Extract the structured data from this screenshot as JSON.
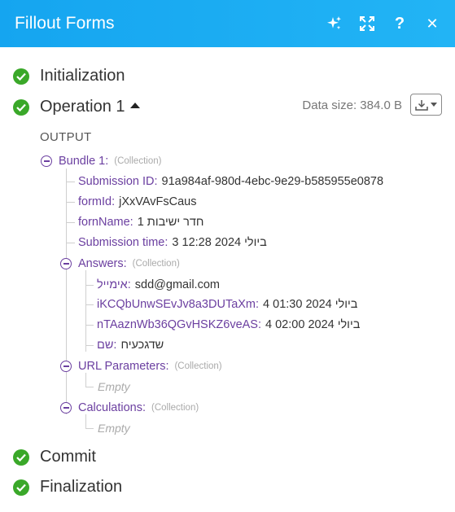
{
  "header": {
    "title": "Fillout Forms",
    "icons": [
      "sparkle-icon",
      "expand-icon",
      "help-icon",
      "close-icon"
    ],
    "help_glyph": "?",
    "close_glyph": "✕"
  },
  "steps": {
    "initialization": "Initialization",
    "operation": "Operation 1",
    "commit": "Commit",
    "finalization": "Finalization"
  },
  "data_size": "Data size: 384.0 B",
  "output_label": "OUTPUT",
  "bundle": {
    "key": "Bundle 1:",
    "type": "(Collection)",
    "submission_id": {
      "key": "Submission ID:",
      "value": "91a984af-980d-4ebc-9e29-b585955e0878"
    },
    "form_id": {
      "key": "formId:",
      "value": "jXxVAvFsCaus"
    },
    "form_name": {
      "key": "fornName:",
      "value": "חדר ישיבות 1"
    },
    "submission_time": {
      "key": "Submission time:",
      "value": "3 ביולי 2024 12:28"
    },
    "answers": {
      "key": "Answers:",
      "type": "(Collection)",
      "email": {
        "key": "אימייל:",
        "value": "sdd@gmail.com"
      },
      "field1": {
        "key": "iKCQbUnwSEvJv8a3DUTaXm:",
        "value": "4 ביולי 2024 01:30"
      },
      "field2": {
        "key": "nTAaznWb36QGvHSKZ6veAS:",
        "value": "4 ביולי 2024 02:00"
      },
      "name": {
        "key": "שם:",
        "value": "שדגכעיח"
      }
    },
    "url_parameters": {
      "key": "URL Parameters:",
      "type": "(Collection)",
      "empty": "Empty"
    },
    "calculations": {
      "key": "Calculations:",
      "type": "(Collection)",
      "empty": "Empty"
    }
  },
  "colors": {
    "header_bg": "#1aa9f2",
    "check_green": "#3aa829",
    "key_purple": "#6b3fa0"
  }
}
